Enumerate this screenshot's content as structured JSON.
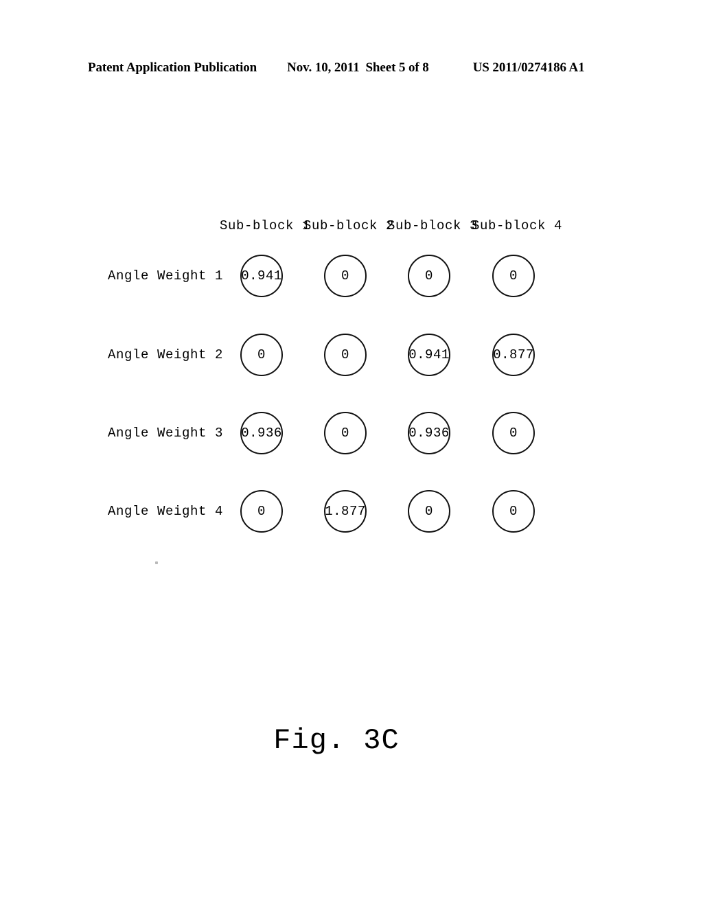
{
  "document": {
    "header": {
      "publication": "Patent Application Publication",
      "date": "Nov. 10, 2011",
      "sheet": "Sheet 5 of 8",
      "patent_number": "US 2011/0274186 A1"
    },
    "figure_caption": "Fig. 3C",
    "ink_color": "#111111",
    "background_color": "#ffffff"
  },
  "figure": {
    "column_headers": [
      "Sub-block 1",
      "Sub-block 2",
      "Sub-block 3",
      "Sub-block 4"
    ],
    "row_labels": [
      "Angle Weight 1",
      "Angle Weight 2",
      "Angle Weight 3",
      "Angle Weight 4"
    ],
    "cells": [
      [
        "0.941",
        "0",
        "0",
        "0"
      ],
      [
        "0",
        "0",
        "0.941",
        "0.877"
      ],
      [
        "0.936",
        "0",
        "0.936",
        "0"
      ],
      [
        "0",
        "1.877",
        "0",
        "0"
      ]
    ]
  },
  "chart_data": {
    "type": "table",
    "title": "Fig. 3C",
    "xlabel": "",
    "ylabel": "",
    "categories": [
      "Sub-block 1",
      "Sub-block 2",
      "Sub-block 3",
      "Sub-block 4"
    ],
    "series": [
      {
        "name": "Angle Weight 1",
        "values": [
          0.941,
          0,
          0,
          0
        ]
      },
      {
        "name": "Angle Weight 2",
        "values": [
          0,
          0,
          0.941,
          0.877
        ]
      },
      {
        "name": "Angle Weight 3",
        "values": [
          0.936,
          0,
          0.936,
          0
        ]
      },
      {
        "name": "Angle Weight 4",
        "values": [
          0,
          1.877,
          0,
          0
        ]
      }
    ],
    "notes": "Each matrix entry is drawn inside a circle outline; zero entries shown as '0'."
  }
}
